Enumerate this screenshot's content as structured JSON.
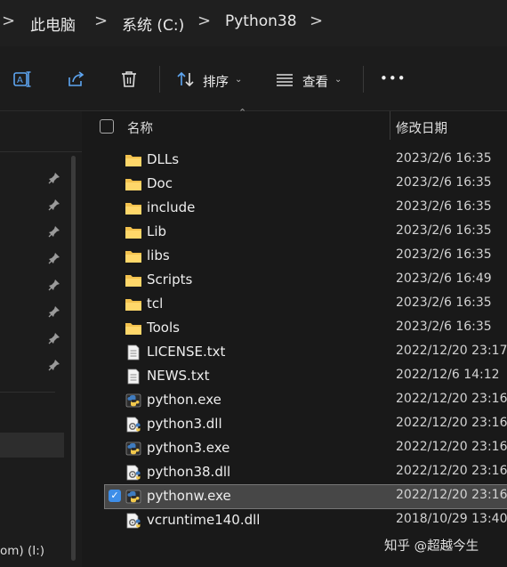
{
  "breadcrumb": {
    "items": [
      "此电脑",
      "系统 (C:)",
      "Python38"
    ],
    "separator": ">"
  },
  "toolbar": {
    "rename_icon": "rename-icon",
    "share_icon": "share-icon",
    "delete_icon": "trash-icon",
    "sort_label": "排序",
    "view_label": "查看",
    "more_label": "•••"
  },
  "nav": {
    "drive_label": "om) (I:)",
    "pins": 8
  },
  "list": {
    "columns": {
      "name": "名称",
      "modified": "修改日期"
    },
    "rows": [
      {
        "name": "DLLs",
        "date": "2023/2/6 16:35",
        "type": "folder"
      },
      {
        "name": "Doc",
        "date": "2023/2/6 16:35",
        "type": "folder"
      },
      {
        "name": "include",
        "date": "2023/2/6 16:35",
        "type": "folder"
      },
      {
        "name": "Lib",
        "date": "2023/2/6 16:35",
        "type": "folder"
      },
      {
        "name": "libs",
        "date": "2023/2/6 16:35",
        "type": "folder"
      },
      {
        "name": "Scripts",
        "date": "2023/2/6 16:49",
        "type": "folder"
      },
      {
        "name": "tcl",
        "date": "2023/2/6 16:35",
        "type": "folder"
      },
      {
        "name": "Tools",
        "date": "2023/2/6 16:35",
        "type": "folder"
      },
      {
        "name": "LICENSE.txt",
        "date": "2022/12/20 23:17",
        "type": "text"
      },
      {
        "name": "NEWS.txt",
        "date": "2022/12/6 14:12",
        "type": "text"
      },
      {
        "name": "python.exe",
        "date": "2022/12/20 23:16",
        "type": "exe"
      },
      {
        "name": "python3.dll",
        "date": "2022/12/20 23:16",
        "type": "dll"
      },
      {
        "name": "python3.exe",
        "date": "2022/12/20 23:16",
        "type": "exe"
      },
      {
        "name": "python38.dll",
        "date": "2022/12/20 23:16",
        "type": "dll"
      },
      {
        "name": "pythonw.exe",
        "date": "2022/12/20 23:16",
        "type": "exe",
        "selected": true
      },
      {
        "name": "vcruntime140.dll",
        "date": "2018/10/29 13:40",
        "type": "dll"
      }
    ]
  },
  "watermark": "知乎 @超越今生",
  "colors": {
    "folder": "#f2c14e",
    "selection": "#474747",
    "checkbox": "#3e8ee8"
  }
}
